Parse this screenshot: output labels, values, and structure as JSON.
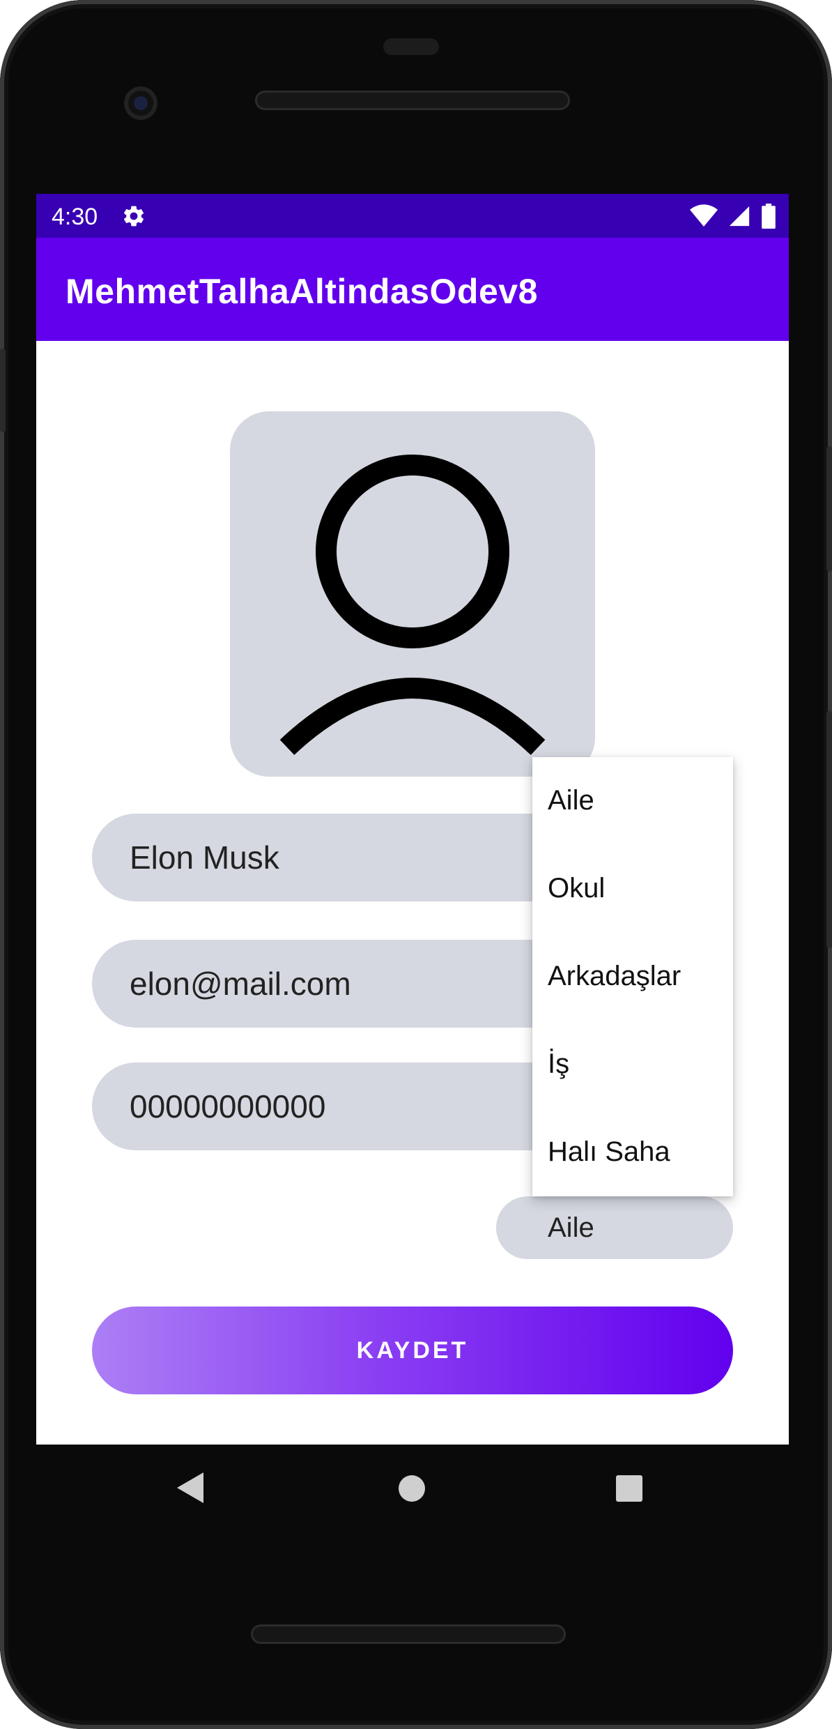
{
  "status_bar": {
    "time": "4:30",
    "icons": [
      "gear-icon",
      "wifi-icon",
      "signal-icon",
      "battery-icon"
    ]
  },
  "app_bar": {
    "title": "MehmetTalhaAltindasOdev8"
  },
  "avatar": {
    "icon": "person-icon"
  },
  "form": {
    "name_value": "Elon Musk",
    "email_value": "elon@mail.com",
    "phone_value": "00000000000",
    "group_selected": "Aile"
  },
  "dropdown": {
    "options": [
      "Aile",
      "Okul",
      "Arkadaşlar",
      "İş",
      "Halı Saha"
    ]
  },
  "save_button": {
    "label": "KAYDET"
  },
  "nav_bar": {
    "icons": [
      "back-icon",
      "home-icon",
      "recents-icon"
    ]
  },
  "colors": {
    "status_bar": "#3700B3",
    "app_bar": "#6200EE",
    "field_bg": "#D5D8E0",
    "button_gradient_start": "#AC7FF5",
    "button_gradient_end": "#6200EE"
  }
}
